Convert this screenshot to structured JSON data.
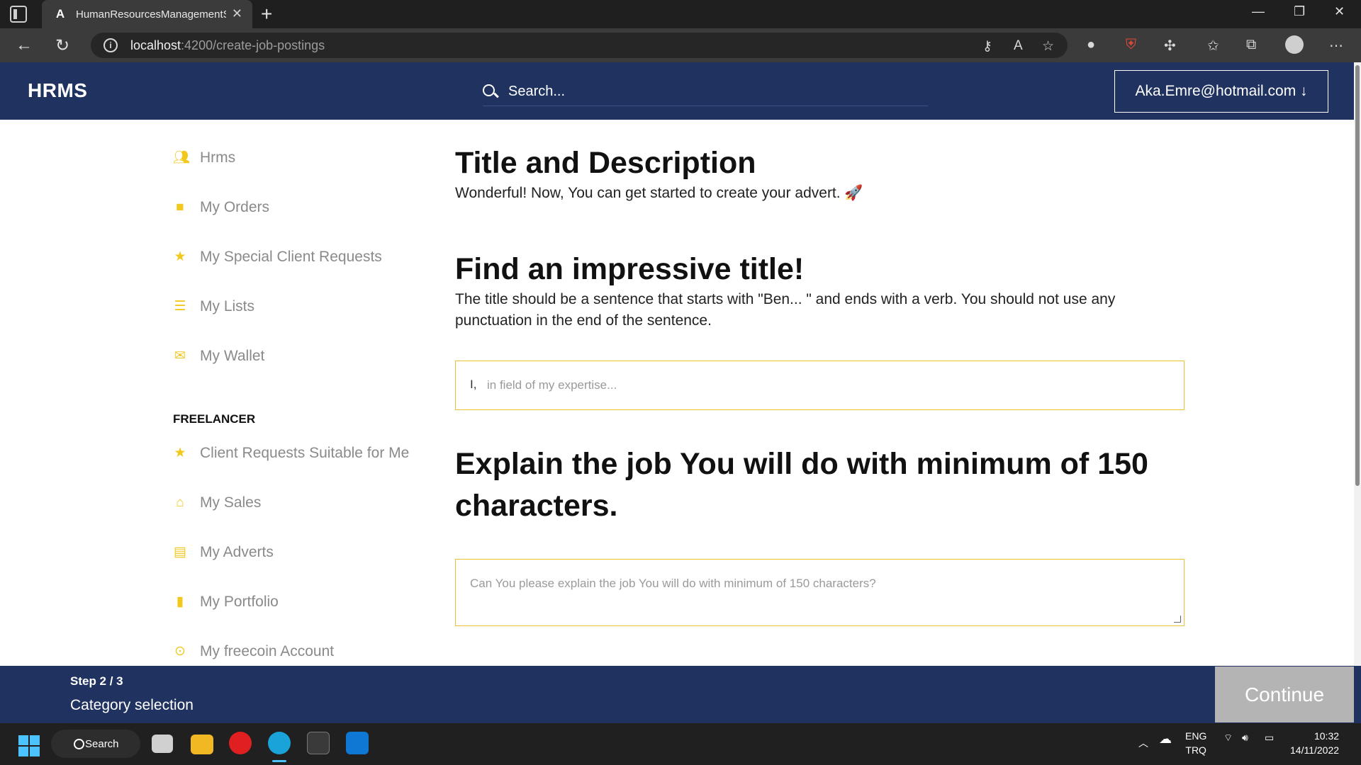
{
  "browser": {
    "tab_title": "HumanResourcesManagementSystem",
    "tab_favicon": "A",
    "url_host": "localhost",
    "url_path": ":4200/create-job-postings"
  },
  "header": {
    "brand": "HRMS",
    "search_placeholder": "Search...",
    "user_label": "Aka.Emre@hotmail.com ↓"
  },
  "sidebar": {
    "items": [
      {
        "label": "Hrms",
        "icon": "users-icon"
      },
      {
        "label": "My Orders",
        "icon": "shopping-bag-icon"
      },
      {
        "label": "My Special Client Requests",
        "icon": "star-icon"
      },
      {
        "label": "My Lists",
        "icon": "list-icon"
      },
      {
        "label": "My Wallet",
        "icon": "envelope-icon"
      }
    ],
    "section_heading": "FREELANCER",
    "freelancer_items": [
      {
        "label": "Client Requests Suitable for Me",
        "icon": "star-icon"
      },
      {
        "label": "My Sales",
        "icon": "store-icon"
      },
      {
        "label": "My Adverts",
        "icon": "file-icon"
      },
      {
        "label": "My Portfolio",
        "icon": "book-icon"
      },
      {
        "label": "My freecoin Account",
        "icon": "coin-icon"
      }
    ]
  },
  "main": {
    "section1_title": "Title and Description",
    "section1_text": "Wonderful! Now, You can get started to create your advert. 🚀",
    "section2_title": "Find an impressive title!",
    "section2_text": "The title should be a sentence that starts with \"Ben... \" and ends with a verb. You should not use any punctuation in the end of the sentence.",
    "title_prefix": "I,",
    "title_placeholder": "in field of my expertise...",
    "section3_title": "Explain the job You will do with minimum of 150 characters.",
    "description_placeholder": "Can You please explain the job You will do with minimum of 150 characters?"
  },
  "footer": {
    "step": "Step 2 / 3",
    "step_label": "Category selection",
    "continue_label": "Continue"
  },
  "taskbar": {
    "search_label": "Search",
    "lang_1": "ENG",
    "lang_2": "TRQ",
    "time": "10:32",
    "date": "14/11/2022"
  },
  "colors": {
    "brand_navy": "#1f3260",
    "accent_yellow": "#f2c81d",
    "continue_disabled": "#b4b4b4"
  }
}
